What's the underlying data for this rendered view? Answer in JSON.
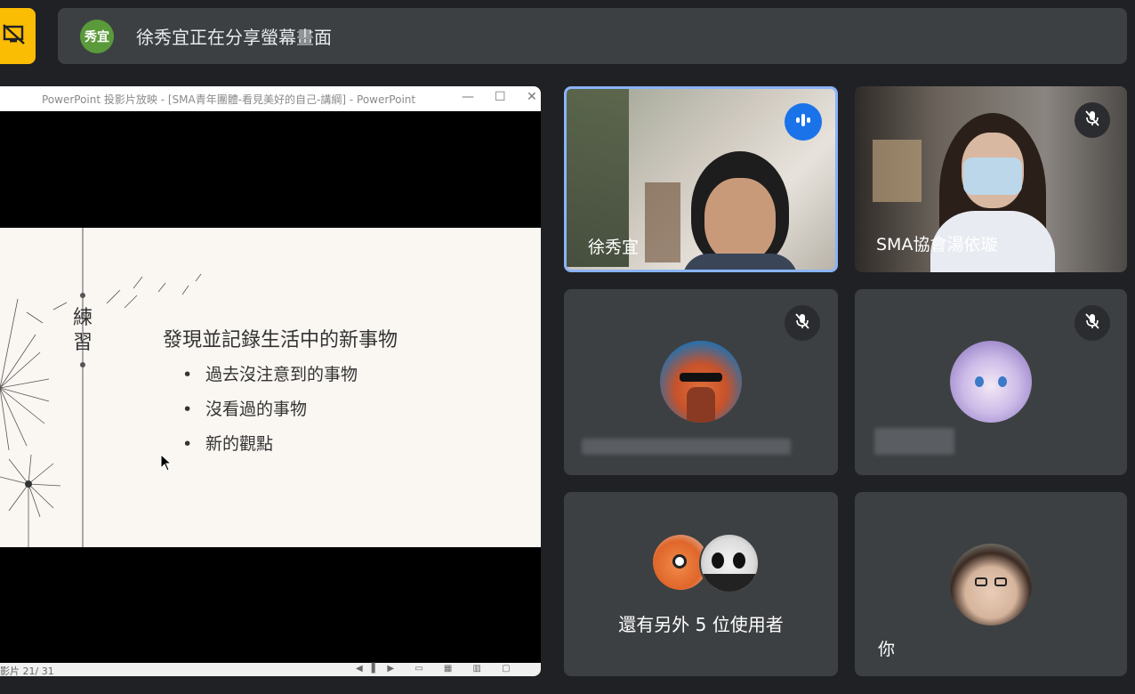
{
  "banner": {
    "presenter_initials": "秀宜",
    "text": "徐秀宜正在分享螢幕畫面",
    "stop_icon": "stop-presenting-icon"
  },
  "powerpoint": {
    "title": "PowerPoint 投影片放映 - [SMA青年團體-看見美好的自己-講綱] - PowerPoint",
    "slide_vertical": "練習",
    "slide_title": "發現並記錄生活中的新事物",
    "bullets": [
      "過去沒注意到的事物",
      "沒看過的事物",
      "新的觀點"
    ],
    "status": "影片 21/ 31"
  },
  "participants": [
    {
      "name": "徐秀宜",
      "state": "speaking"
    },
    {
      "name": "SMA協會湯依璇",
      "state": "muted"
    },
    {
      "name": "",
      "state": "muted"
    },
    {
      "name": "",
      "state": "muted"
    },
    {
      "name": "還有另外 5 位使用者",
      "state": "group"
    },
    {
      "name": "你",
      "state": "self"
    }
  ],
  "colors": {
    "background": "#202124",
    "tile": "#3c4043",
    "stop_button": "#fbbc04",
    "speaking_accent": "#1a73e8",
    "presenter_avatar": "#5b9a3a"
  }
}
